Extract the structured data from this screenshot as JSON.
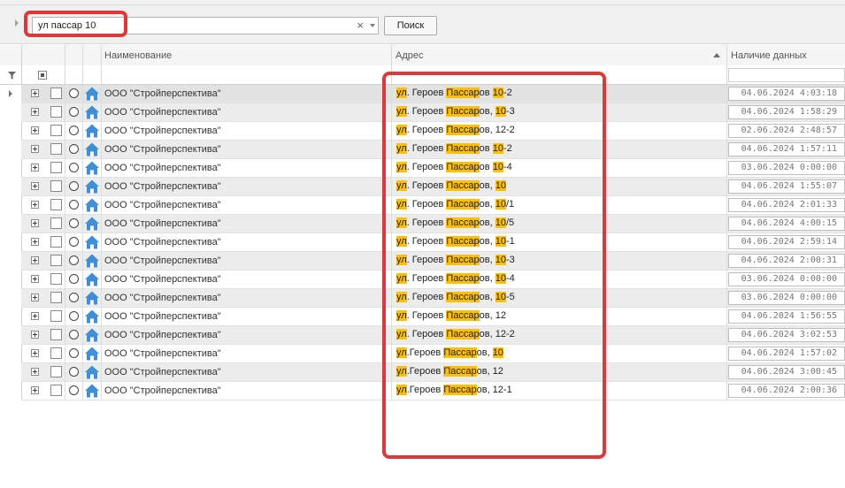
{
  "search": {
    "value": "ул пассар 10",
    "clear_glyph": "×",
    "button_label": "Поиск"
  },
  "columns": {
    "name": "Наименование",
    "address": "Адрес",
    "data_presence": "Наличие данных"
  },
  "icons": {
    "row_type": "house-icon",
    "filter": "filter-icon",
    "expander": "plus-expander-icon"
  },
  "colors": {
    "highlight": "#ffc000",
    "callout": "#e0383a",
    "house": "#3f8fd6"
  },
  "rows": [
    {
      "name": "ООО \"Стройперспектива\"",
      "address": [
        [
          "ул",
          true
        ],
        [
          ". Героев ",
          false
        ],
        [
          "Пассар",
          true
        ],
        [
          "ов ",
          false
        ],
        [
          "10",
          true
        ],
        [
          "-2",
          false
        ]
      ],
      "date": "04.06.2024 4:03:18"
    },
    {
      "name": "ООО \"Стройперспектива\"",
      "address": [
        [
          "ул",
          true
        ],
        [
          ". Героев ",
          false
        ],
        [
          "Пассар",
          true
        ],
        [
          "ов, ",
          false
        ],
        [
          "10",
          true
        ],
        [
          "-3",
          false
        ]
      ],
      "date": "04.06.2024 1:58:29"
    },
    {
      "name": "ООО \"Стройперспектива\"",
      "address": [
        [
          "ул",
          true
        ],
        [
          ". Героев ",
          false
        ],
        [
          "Пассар",
          true
        ],
        [
          "ов, 12-2",
          false
        ]
      ],
      "date": "02.06.2024 2:48:57"
    },
    {
      "name": "ООО \"Стройперспектива\"",
      "address": [
        [
          "ул",
          true
        ],
        [
          ". Героев ",
          false
        ],
        [
          "Пассар",
          true
        ],
        [
          "ов ",
          false
        ],
        [
          "10",
          true
        ],
        [
          "-2",
          false
        ]
      ],
      "date": "04.06.2024 1:57:11"
    },
    {
      "name": "ООО \"Стройперспектива\"",
      "address": [
        [
          "ул",
          true
        ],
        [
          ". Героев ",
          false
        ],
        [
          "Пассар",
          true
        ],
        [
          "ов ",
          false
        ],
        [
          "10",
          true
        ],
        [
          "-4",
          false
        ]
      ],
      "date": "03.06.2024 0:00:00"
    },
    {
      "name": "ООО \"Стройперспектива\"",
      "address": [
        [
          "ул",
          true
        ],
        [
          ". Героев ",
          false
        ],
        [
          "Пассар",
          true
        ],
        [
          "ов, ",
          false
        ],
        [
          "10",
          true
        ]
      ],
      "date": "04.06.2024 1:55:07"
    },
    {
      "name": "ООО \"Стройперспектива\"",
      "address": [
        [
          "ул",
          true
        ],
        [
          ". Героев ",
          false
        ],
        [
          "Пассар",
          true
        ],
        [
          "ов, ",
          false
        ],
        [
          "10",
          true
        ],
        [
          "/1",
          false
        ]
      ],
      "date": "04.06.2024 2:01:33"
    },
    {
      "name": "ООО \"Стройперспектива\"",
      "address": [
        [
          "ул",
          true
        ],
        [
          ". Героев ",
          false
        ],
        [
          "Пассар",
          true
        ],
        [
          "ов, ",
          false
        ],
        [
          "10",
          true
        ],
        [
          "/5",
          false
        ]
      ],
      "date": "04.06.2024 4:00:15"
    },
    {
      "name": "ООО \"Стройперспектива\"",
      "address": [
        [
          "ул",
          true
        ],
        [
          ". Героев ",
          false
        ],
        [
          "Пассар",
          true
        ],
        [
          "ов, ",
          false
        ],
        [
          "10",
          true
        ],
        [
          "-1",
          false
        ]
      ],
      "date": "04.06.2024 2:59:14"
    },
    {
      "name": "ООО \"Стройперспектива\"",
      "address": [
        [
          "ул",
          true
        ],
        [
          ". Героев ",
          false
        ],
        [
          "Пассар",
          true
        ],
        [
          "ов, ",
          false
        ],
        [
          "10",
          true
        ],
        [
          "-3",
          false
        ]
      ],
      "date": "04.06.2024 2:00:31"
    },
    {
      "name": "ООО \"Стройперспектива\"",
      "address": [
        [
          "ул",
          true
        ],
        [
          ". Героев ",
          false
        ],
        [
          "Пассар",
          true
        ],
        [
          "ов, ",
          false
        ],
        [
          "10",
          true
        ],
        [
          "-4",
          false
        ]
      ],
      "date": "03.06.2024 0:00:00"
    },
    {
      "name": "ООО \"Стройперспектива\"",
      "address": [
        [
          "ул",
          true
        ],
        [
          ". Героев ",
          false
        ],
        [
          "Пассар",
          true
        ],
        [
          "ов, ",
          false
        ],
        [
          "10",
          true
        ],
        [
          "-5",
          false
        ]
      ],
      "date": "03.06.2024 0:00:00"
    },
    {
      "name": "ООО \"Стройперспектива\"",
      "address": [
        [
          "ул",
          true
        ],
        [
          ". Героев ",
          false
        ],
        [
          "Пассар",
          true
        ],
        [
          "ов, 12",
          false
        ]
      ],
      "date": "04.06.2024 1:56:55"
    },
    {
      "name": "ООО \"Стройперспектива\"",
      "address": [
        [
          "ул",
          true
        ],
        [
          ". Героев ",
          false
        ],
        [
          "Пассар",
          true
        ],
        [
          "ов, 12-2",
          false
        ]
      ],
      "date": "04.06.2024 3:02:53"
    },
    {
      "name": "ООО \"Стройперспектива\"",
      "address": [
        [
          "ул",
          true
        ],
        [
          ".Героев ",
          false
        ],
        [
          "Пассар",
          true
        ],
        [
          "ов, ",
          false
        ],
        [
          "10",
          true
        ]
      ],
      "date": "04.06.2024 1:57:02"
    },
    {
      "name": "ООО \"Стройперспектива\"",
      "address": [
        [
          "ул",
          true
        ],
        [
          ".Героев ",
          false
        ],
        [
          "Пассар",
          true
        ],
        [
          "ов, 12",
          false
        ]
      ],
      "date": "04.06.2024 3:00:45"
    },
    {
      "name": "ООО \"Стройперспектива\"",
      "address": [
        [
          "ул",
          true
        ],
        [
          ".Героев ",
          false
        ],
        [
          "Пассар",
          true
        ],
        [
          "ов, 12-1",
          false
        ]
      ],
      "date": "04.06.2024 2:00:36"
    }
  ]
}
